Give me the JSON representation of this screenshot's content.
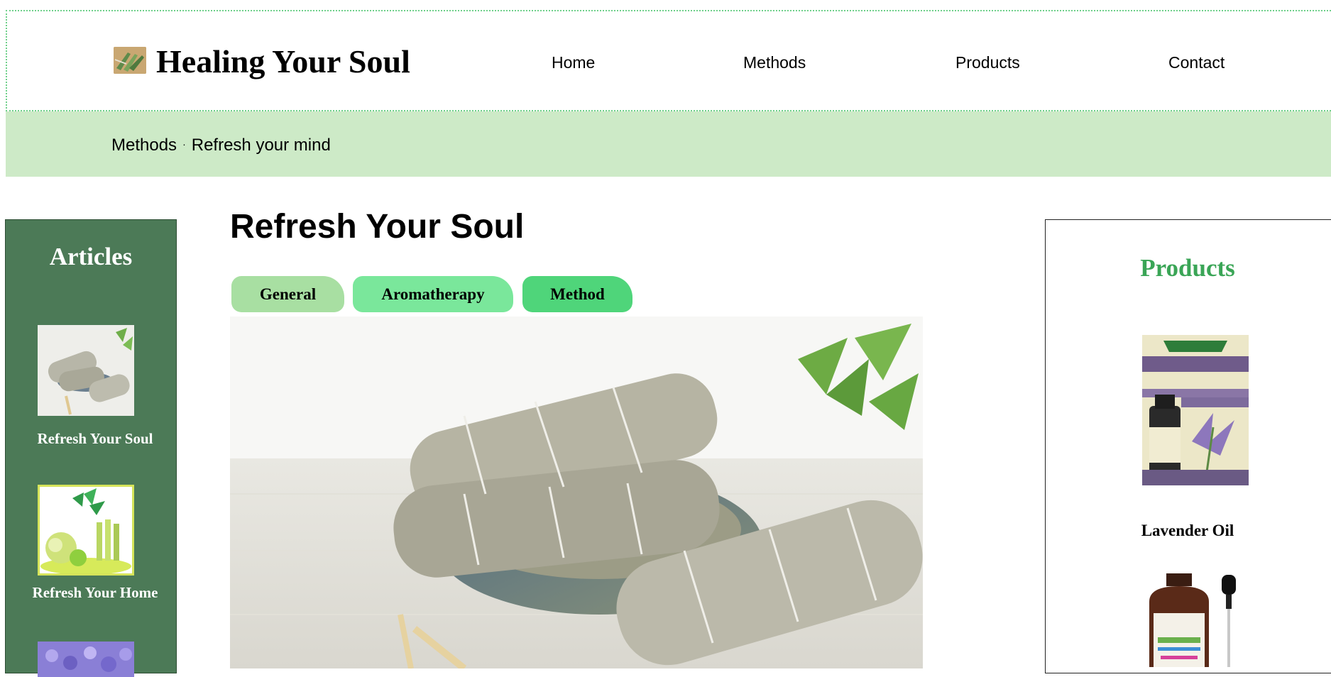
{
  "header": {
    "site_title": "Healing Your Soul",
    "nav": [
      "Home",
      "Methods",
      "Products",
      "Contact"
    ]
  },
  "breadcrumb": {
    "section": "Methods",
    "separator": "·",
    "page": "Refresh your mind"
  },
  "sidebar": {
    "title": "Articles",
    "articles": [
      {
        "label": "Refresh Your Soul"
      },
      {
        "label": "Refresh Your Home"
      },
      {
        "label": ""
      }
    ]
  },
  "main": {
    "title": "Refresh Your Soul",
    "tabs": [
      {
        "label": "General",
        "color": "#a8dfa2"
      },
      {
        "label": "Aromatherapy",
        "color": "#7ae79b"
      },
      {
        "label": "Method",
        "color": "#4fd57a"
      }
    ]
  },
  "products": {
    "title": "Products",
    "items": [
      {
        "label": "Lavender Oil"
      },
      {
        "label": ""
      }
    ]
  },
  "colors": {
    "header_border": "#6fd08a",
    "breadcrumb_bg": "#cdeac7",
    "sidebar_bg": "#4c7a57",
    "products_title": "#3aa556"
  }
}
